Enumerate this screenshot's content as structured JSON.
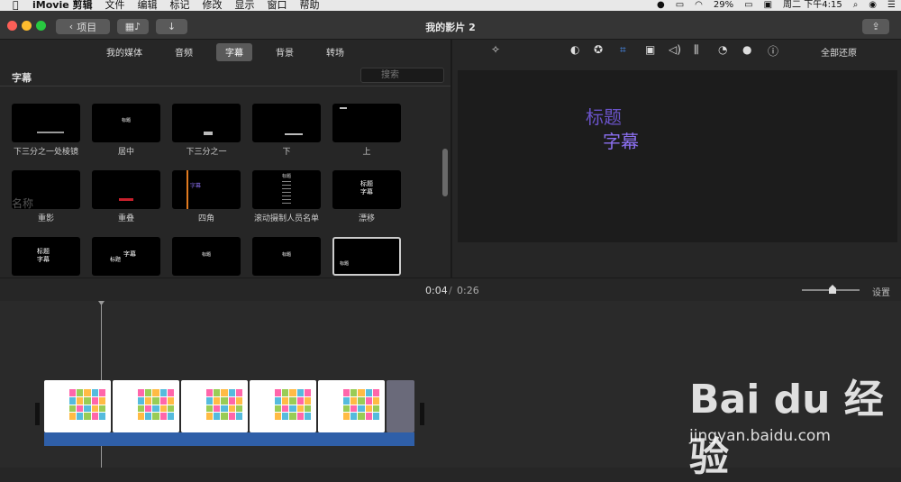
{
  "menubar": {
    "app": "iMovie 剪辑",
    "items": [
      "文件",
      "编辑",
      "标记",
      "修改",
      "显示",
      "窗口",
      "帮助"
    ],
    "battery": "29%",
    "datetime": "周二 下午4:15"
  },
  "toolbar": {
    "back_label": "项目",
    "window_title": "我的影片 2"
  },
  "tabs": [
    "我的媒体",
    "音频",
    "字幕",
    "背景",
    "转场"
  ],
  "section_title": "字幕",
  "search_placeholder": "搜索",
  "titles": [
    {
      "label": "下三分之一处棱镜",
      "preview": "",
      "sub": ""
    },
    {
      "label": "居中",
      "preview": "标题",
      "sub": ""
    },
    {
      "label": "下三分之一",
      "preview": "",
      "sub": ""
    },
    {
      "label": "下",
      "preview": "",
      "sub": ""
    },
    {
      "label": "上",
      "preview": "",
      "sub": ""
    },
    {
      "label": "重影",
      "preview": "名称",
      "sub": ""
    },
    {
      "label": "重叠",
      "preview": "",
      "sub": ""
    },
    {
      "label": "四角",
      "preview": "字幕",
      "sub": ""
    },
    {
      "label": "滚动摄制人员名单",
      "preview": "标题",
      "sub": ""
    },
    {
      "label": "漂移",
      "preview": "标题",
      "sub": "字幕"
    },
    {
      "label": "",
      "preview": "标题",
      "sub": "字幕"
    },
    {
      "label": "",
      "preview": "标题",
      "sub": "字幕"
    },
    {
      "label": "",
      "preview": "标题",
      "sub": ""
    },
    {
      "label": "",
      "preview": "标题",
      "sub": ""
    },
    {
      "label": "",
      "preview": "标题",
      "sub": ""
    }
  ],
  "viewer": {
    "reset_label": "全部还原",
    "title_line1": "标题",
    "title_line2": "字幕"
  },
  "playback": {
    "current": "0:04",
    "separator": "/",
    "total": "0:26"
  },
  "settings_label": "设置",
  "watermark": {
    "brand": "Bai du 经验",
    "url": "jingyan.baidu.com"
  },
  "colors": {
    "accent": "#8b6ff0",
    "blue_bar": "#2f5fa8",
    "selected_tab": "#5a5a5a"
  }
}
